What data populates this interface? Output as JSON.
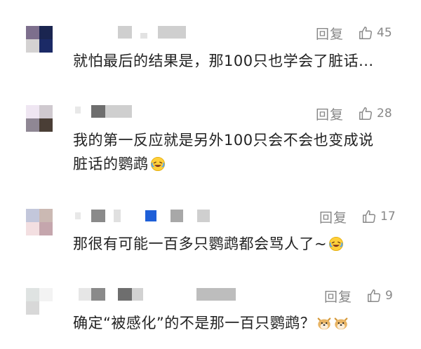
{
  "reply_label": "回复",
  "colors": {
    "secondary_text": "#888888",
    "primary_text": "#222222",
    "background": "#ffffff",
    "mosaic_gray": "#c8c8c8",
    "mosaic_blue": "#1e5fd8"
  },
  "comments": [
    {
      "likes": "45",
      "text": "就怕最后的结果是，那100只也学会了脏话...",
      "avatar_colors": [
        "#7d6f8d",
        "#1a2550",
        "#d4d2d2",
        "#1b2a66"
      ],
      "emojis": []
    },
    {
      "likes": "28",
      "text": "我的第一反应就是另外100只会不会也变成说",
      "text_line2": "脏话的鹦鹉",
      "avatar_colors": [
        "#efe6f2",
        "#cfc9cf",
        "#8f8794",
        "#4a3e36"
      ],
      "emojis": [
        "laugh-cry-emoji"
      ]
    },
    {
      "likes": "17",
      "text": "那很有可能一百多只鹦鹉都会骂人了~",
      "avatar_colors": [
        "#c3c7db",
        "#cbb9b3",
        "#f3dfe1",
        "#c5a6ad"
      ],
      "emojis": [
        "laugh-cry-emoji"
      ]
    },
    {
      "likes": "9",
      "text": "确定“被感化”的不是那一百只鹦鹉？",
      "avatar_colors": [
        "#dfe3e2",
        "#f3f3f3",
        "#d8d8d8",
        "#ffffff"
      ],
      "emojis": [
        "doge-emoji",
        "doge-emoji"
      ]
    }
  ]
}
